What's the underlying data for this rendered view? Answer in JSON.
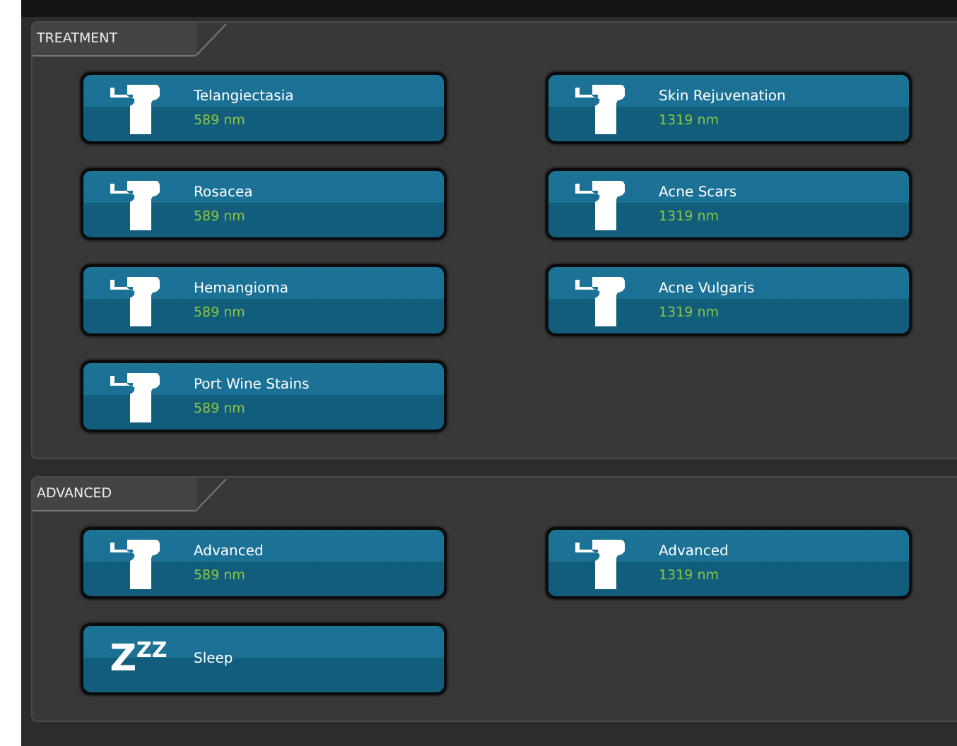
{
  "sections": [
    {
      "title": "TREATMENT",
      "buttons": [
        {
          "kind": "handpiece",
          "label": "Telangiectasia",
          "wavelength": "589 nm"
        },
        {
          "kind": "handpiece",
          "label": "Skin Rejuvenation",
          "wavelength": "1319 nm"
        },
        {
          "kind": "handpiece",
          "label": "Rosacea",
          "wavelength": "589 nm"
        },
        {
          "kind": "handpiece",
          "label": "Acne Scars",
          "wavelength": "1319 nm"
        },
        {
          "kind": "handpiece",
          "label": "Hemangioma",
          "wavelength": "589 nm"
        },
        {
          "kind": "handpiece",
          "label": "Acne Vulgaris",
          "wavelength": "1319 nm"
        },
        {
          "kind": "handpiece",
          "label": "Port Wine Stains",
          "wavelength": "589 nm"
        }
      ]
    },
    {
      "title": "ADVANCED",
      "buttons": [
        {
          "kind": "handpiece",
          "label": "Advanced",
          "wavelength": "589 nm"
        },
        {
          "kind": "handpiece",
          "label": "Advanced",
          "wavelength": "1319 nm"
        },
        {
          "kind": "sleep",
          "label": "Sleep",
          "icon_text": "Z",
          "icon_sup": "ZZ"
        }
      ]
    }
  ]
}
